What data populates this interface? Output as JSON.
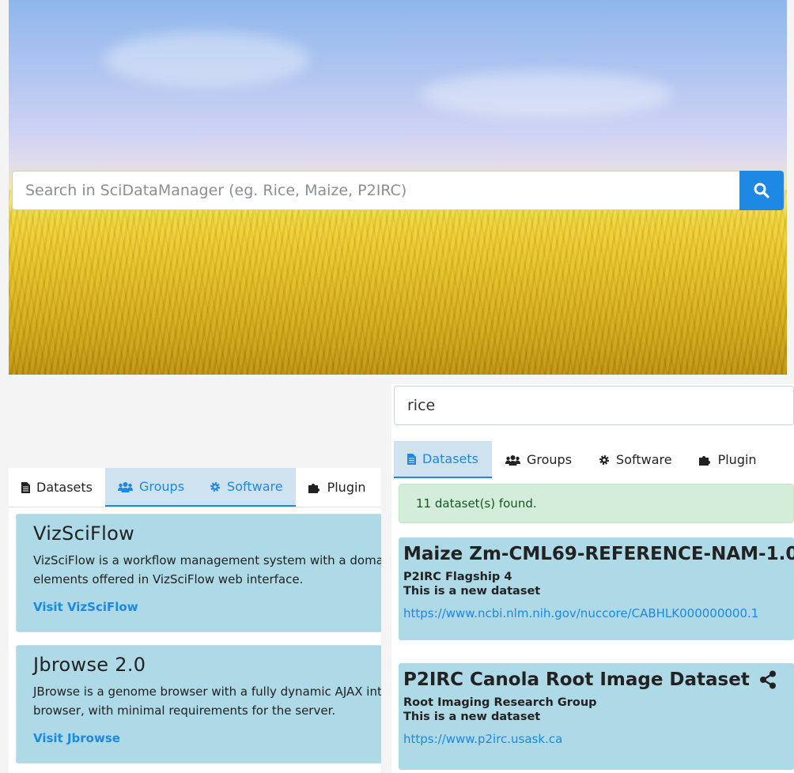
{
  "hero": {
    "search_placeholder": "Search in SciDataManager (eg. Rice, Maize, P2IRC)",
    "search_button_icon": "search-icon"
  },
  "left_panel": {
    "tabs": [
      {
        "label": "Datasets",
        "icon": "document-icon",
        "active": false
      },
      {
        "label": "Groups",
        "icon": "users-icon",
        "active": true
      },
      {
        "label": "Software",
        "icon": "gear-icon",
        "active": true
      },
      {
        "label": "Plugin",
        "icon": "puzzle-icon",
        "active": false
      }
    ],
    "cards": [
      {
        "title": "VizSciFlow",
        "description_line1": "VizSciFlow is a workflow management system with a domain-",
        "description_line2": "elements offered in VizSciFlow web interface.",
        "link": "Visit VizSciFlow"
      },
      {
        "title": "Jbrowse 2.0",
        "description_line1": "JBrowse is a genome browser with a fully dynamic AJAX inter",
        "description_line2": "browser, with minimal requirements for the server.",
        "link": "Visit Jbrowse"
      }
    ]
  },
  "right_panel": {
    "search_value": "rice",
    "tabs": [
      {
        "label": "Datasets",
        "icon": "document-icon",
        "active": true
      },
      {
        "label": "Groups",
        "icon": "users-icon",
        "active": false
      },
      {
        "label": "Software",
        "icon": "gear-icon",
        "active": false
      },
      {
        "label": "Plugin",
        "icon": "puzzle-icon",
        "active": false
      }
    ],
    "result_count": "11 dataset(s) found.",
    "datasets": [
      {
        "title": "Maize Zm-CML69-REFERENCE-NAM-1.0",
        "group": "P2IRC Flagship 4",
        "description": "This is a new dataset",
        "url": "https://www.ncbi.nlm.nih.gov/nuccore/CABHLK000000000.1"
      },
      {
        "title": "P2IRC Canola Root Image Dataset",
        "group": "Root Imaging Research Group",
        "description": "This is a new dataset",
        "url": "https://www.p2irc.usask.ca"
      }
    ]
  },
  "colors": {
    "accent": "#1e88e5",
    "card_bg": "#aed9e6",
    "alert_bg": "#d4edda",
    "alert_text": "#155724"
  }
}
